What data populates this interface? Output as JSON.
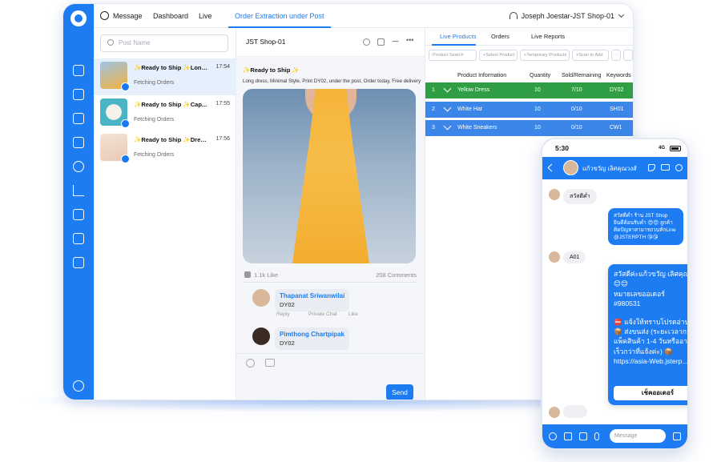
{
  "topbar": {
    "nav": [
      "Message",
      "Dashboard",
      "Live",
      "Order Extraction under Post"
    ],
    "user": "Joseph Joestar-JST Shop-01"
  },
  "postlist": {
    "search_placeholder": "Post Name",
    "items": [
      {
        "title": "✨Ready to Ship ✨Long Dress...",
        "time": "17:54",
        "status": "Fetching Orders"
      },
      {
        "title": "✨Ready to Ship ✨Cap...",
        "time": "17:55",
        "status": "Fetching Orders"
      },
      {
        "title": "✨Ready to Ship ✨Dress...",
        "time": "17:56",
        "status": "Fetching Orders"
      }
    ]
  },
  "detail": {
    "shop": "JST Shop-01",
    "title": "✨Ready to Ship ✨",
    "desc": "Long dress, Minimal Style, Print DY02, under the post, Order today, Free delivery",
    "likes": "1.1k Like",
    "comments_count": "208 Comments",
    "comments": [
      {
        "name": "Thapanat Sriwanwilai",
        "text": "DY02",
        "actions": [
          "Reply",
          "Private Chat",
          "Like"
        ]
      },
      {
        "name": "Pimthong Chartpipak",
        "text": "DY02"
      }
    ],
    "send": "Send"
  },
  "live": {
    "tabs": [
      "Live Products",
      "Orders",
      "Live Reports"
    ],
    "filters": [
      "Product Search",
      "+Select Product",
      "+Temporary Products",
      "+Scan to Add",
      "···"
    ],
    "headers": [
      "Product Information",
      "Quantity",
      "Sold/Remaining",
      "Keywords"
    ],
    "rows": [
      {
        "no": "1",
        "name": "Yellow Dress",
        "qty": "10",
        "sold": "7/10",
        "kw": "DY02"
      },
      {
        "no": "2",
        "name": "White Hat",
        "qty": "10",
        "sold": "0/10",
        "kw": "SH01"
      },
      {
        "no": "3",
        "name": "White Sneakers",
        "qty": "10",
        "sold": "0/10",
        "kw": "CW1"
      }
    ]
  },
  "phone": {
    "time": "5:30",
    "network": "4G",
    "contact": "แก้วขวัญ เลิศคุณวงส์",
    "msg1": "สวัสดีค่ำ",
    "reply1": "สวัสดีค่ำ ร้าน JST Shop ยินดีต้อนรับค่ำ 😍😍 ลูกค้าติดปัญหาสามารถวนทักLine @JSTERPTH 😘😘",
    "msg2": "A01",
    "order_lines": [
      "สวัสดีค่ะแก้วขวัญ เลิศคุณวงส์ 😊😊",
      "หมายเลขออเดอร์",
      "#980531",
      "",
      "⛔ แจ้งให้ทราบโปรดอ่าน ⛔",
      "📦 ส่งขนส่ง (ระยะเวลาการแพ็คสินค้า 1-4 วันหรืออาจจะเร็วกว่าที่แจ้งค่ะ) 📦",
      "https://asia-Web.jsterp..."
    ],
    "check_order": "เช็คออเดอร์",
    "message_placeholder": "Message"
  }
}
